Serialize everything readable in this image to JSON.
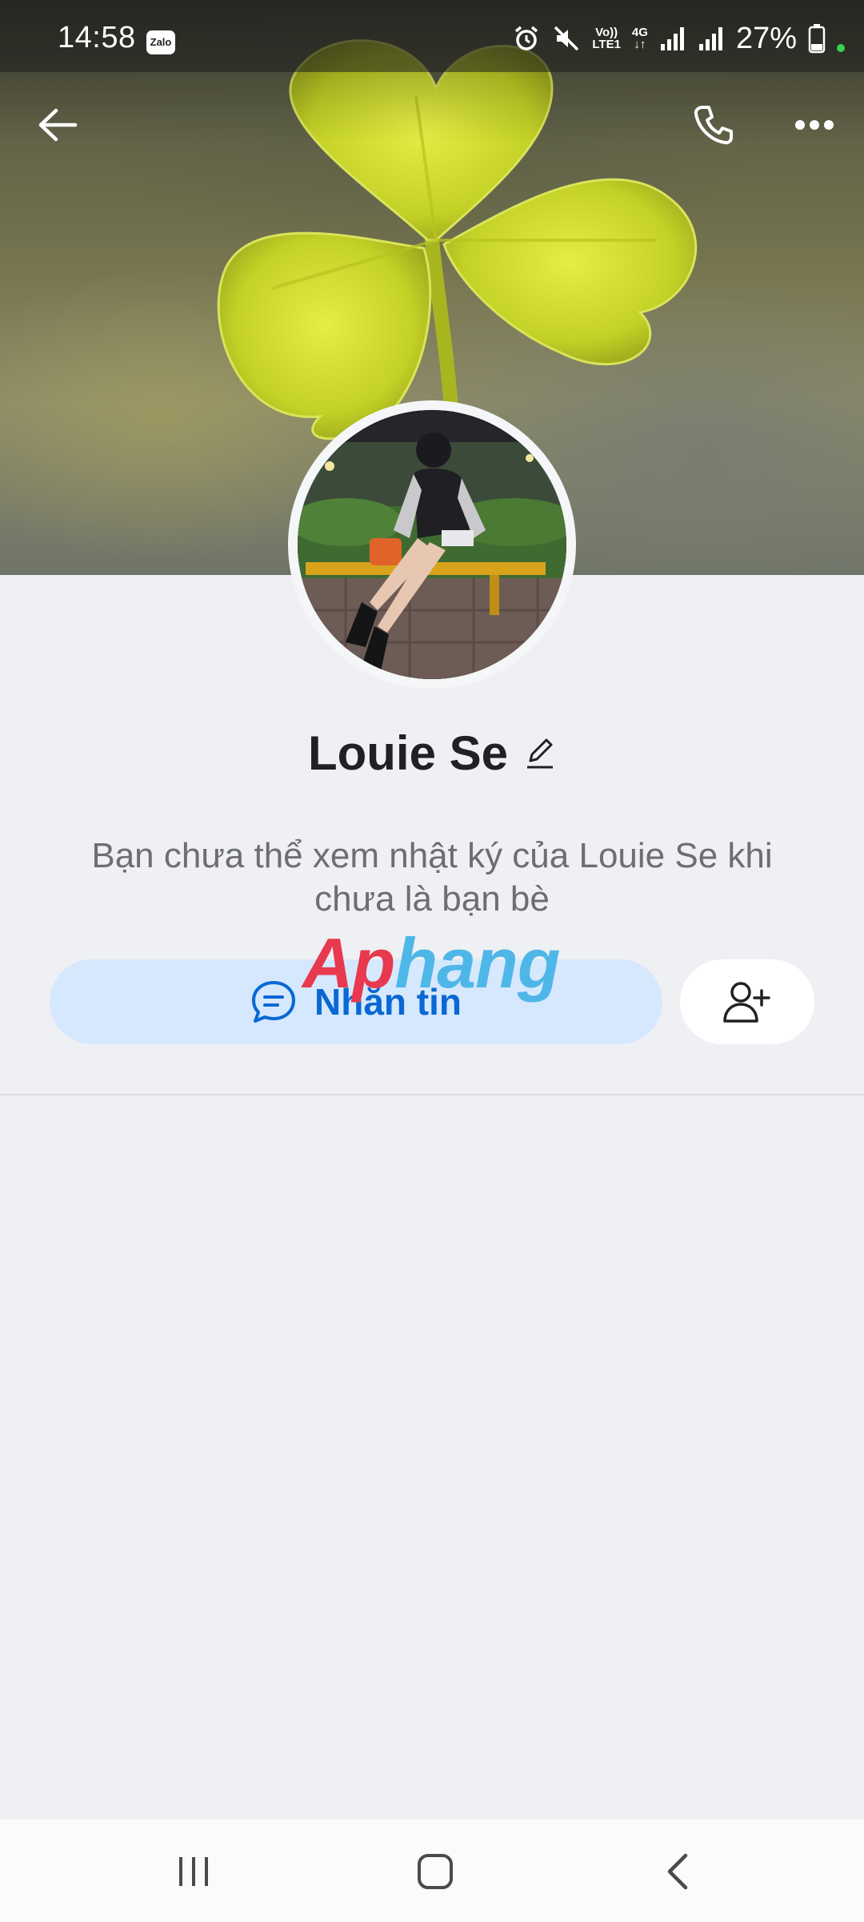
{
  "status_bar": {
    "time": "14:58",
    "app_badge": "Zalo",
    "volte_top": "Vo))",
    "volte_bottom": "LTE1",
    "network": "4G",
    "battery": "27%",
    "icons": [
      "alarm-icon",
      "mute-icon",
      "signal-icon",
      "signal-icon",
      "battery-icon"
    ]
  },
  "header": {
    "back_icon": "back-arrow-icon",
    "call_icon": "phone-icon",
    "more_icon": "more-dots-icon"
  },
  "profile": {
    "name": "Louie Se",
    "edit_icon": "pencil-icon",
    "notice": "Bạn chưa thể xem nhật ký của Louie Se khi chưa là bạn bè"
  },
  "watermark": {
    "part1": "Ap",
    "part2": "hang"
  },
  "actions": {
    "message_label": "Nhắn tin",
    "message_icon": "chat-bubble-icon",
    "add_friend_icon": "add-friend-icon"
  },
  "nav_bar": {
    "icons": [
      "recent-apps-icon",
      "home-icon",
      "nav-back-icon"
    ]
  },
  "colors": {
    "accent": "#0a68d4",
    "message_button_bg": "#d6e8fd",
    "page_bg": "#eff0f4"
  }
}
